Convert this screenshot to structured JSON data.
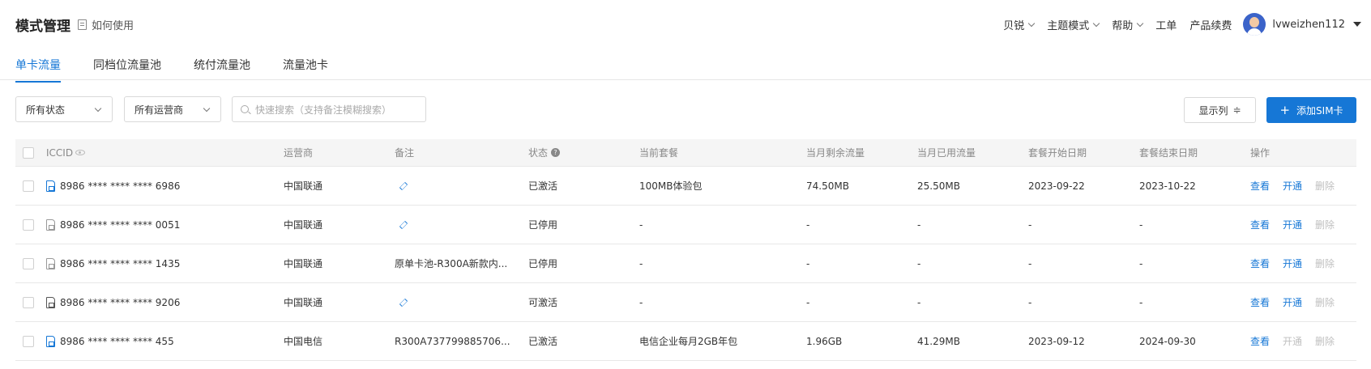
{
  "header": {
    "title": "模式管理",
    "howto_label": "如何使用",
    "nav": {
      "brand": "贝锐",
      "theme": "主题模式",
      "help": "帮助",
      "ticket": "工单",
      "renew": "产品续费",
      "username": "lvweizhen112"
    }
  },
  "tabs": [
    {
      "label": "单卡流量",
      "active": true
    },
    {
      "label": "同档位流量池",
      "active": false
    },
    {
      "label": "统付流量池",
      "active": false
    },
    {
      "label": "流量池卡",
      "active": false
    }
  ],
  "filters": {
    "status_value": "所有状态",
    "carrier_value": "所有运营商",
    "search_placeholder": "快速搜索（支持备注模糊搜索）"
  },
  "toolbar": {
    "columns_label": "显示列",
    "add_label": "添加SIM卡"
  },
  "table": {
    "headers": {
      "iccid": "ICCID",
      "carrier": "运营商",
      "remark": "备注",
      "status": "状态",
      "plan": "当前套餐",
      "remaining": "当月剩余流量",
      "used": "当月已用流量",
      "start": "套餐开始日期",
      "end": "套餐结束日期",
      "ops": "操作"
    },
    "rows": [
      {
        "iccid": "8986 **** **** **** 6986",
        "icon": "sim-blue",
        "carrier": "中国联通",
        "remark": "",
        "status": "已激活",
        "plan": "100MB体验包",
        "remaining": "74.50MB",
        "used": "25.50MB",
        "start": "2023-09-22",
        "end": "2023-10-22",
        "view": "查看",
        "open": "开通",
        "delete": "删除",
        "open_enabled": true
      },
      {
        "iccid": "8986 **** **** **** 0051",
        "icon": "sim-gray",
        "carrier": "中国联通",
        "remark": "",
        "status": "已停用",
        "plan": "-",
        "remaining": "-",
        "used": "-",
        "start": "-",
        "end": "-",
        "view": "查看",
        "open": "开通",
        "delete": "删除",
        "open_enabled": true
      },
      {
        "iccid": "8986 **** **** **** 1435",
        "icon": "sim-gray",
        "carrier": "中国联通",
        "remark": "原单卡池-R300A新款内...",
        "status": "已停用",
        "plan": "-",
        "remaining": "-",
        "used": "-",
        "start": "-",
        "end": "-",
        "view": "查看",
        "open": "开通",
        "delete": "删除",
        "open_enabled": true
      },
      {
        "iccid": "8986 **** **** **** 9206",
        "icon": "sim-dark",
        "carrier": "中国联通",
        "remark": "",
        "status": "可激活",
        "plan": "-",
        "remaining": "-",
        "used": "-",
        "start": "-",
        "end": "-",
        "view": "查看",
        "open": "开通",
        "delete": "删除",
        "open_enabled": true
      },
      {
        "iccid": "8986 **** **** **** 455",
        "icon": "sim-blue",
        "carrier": "中国电信",
        "remark": "R300A737799885706...",
        "status": "已激活",
        "plan": "电信企业每月2GB年包",
        "remaining": "1.96GB",
        "used": "41.29MB",
        "start": "2023-09-12",
        "end": "2024-09-30",
        "view": "查看",
        "open": "开通",
        "delete": "删除",
        "open_enabled": false
      }
    ]
  },
  "colors": {
    "accent": "#1677d6",
    "disabled": "#bfbfbf"
  }
}
